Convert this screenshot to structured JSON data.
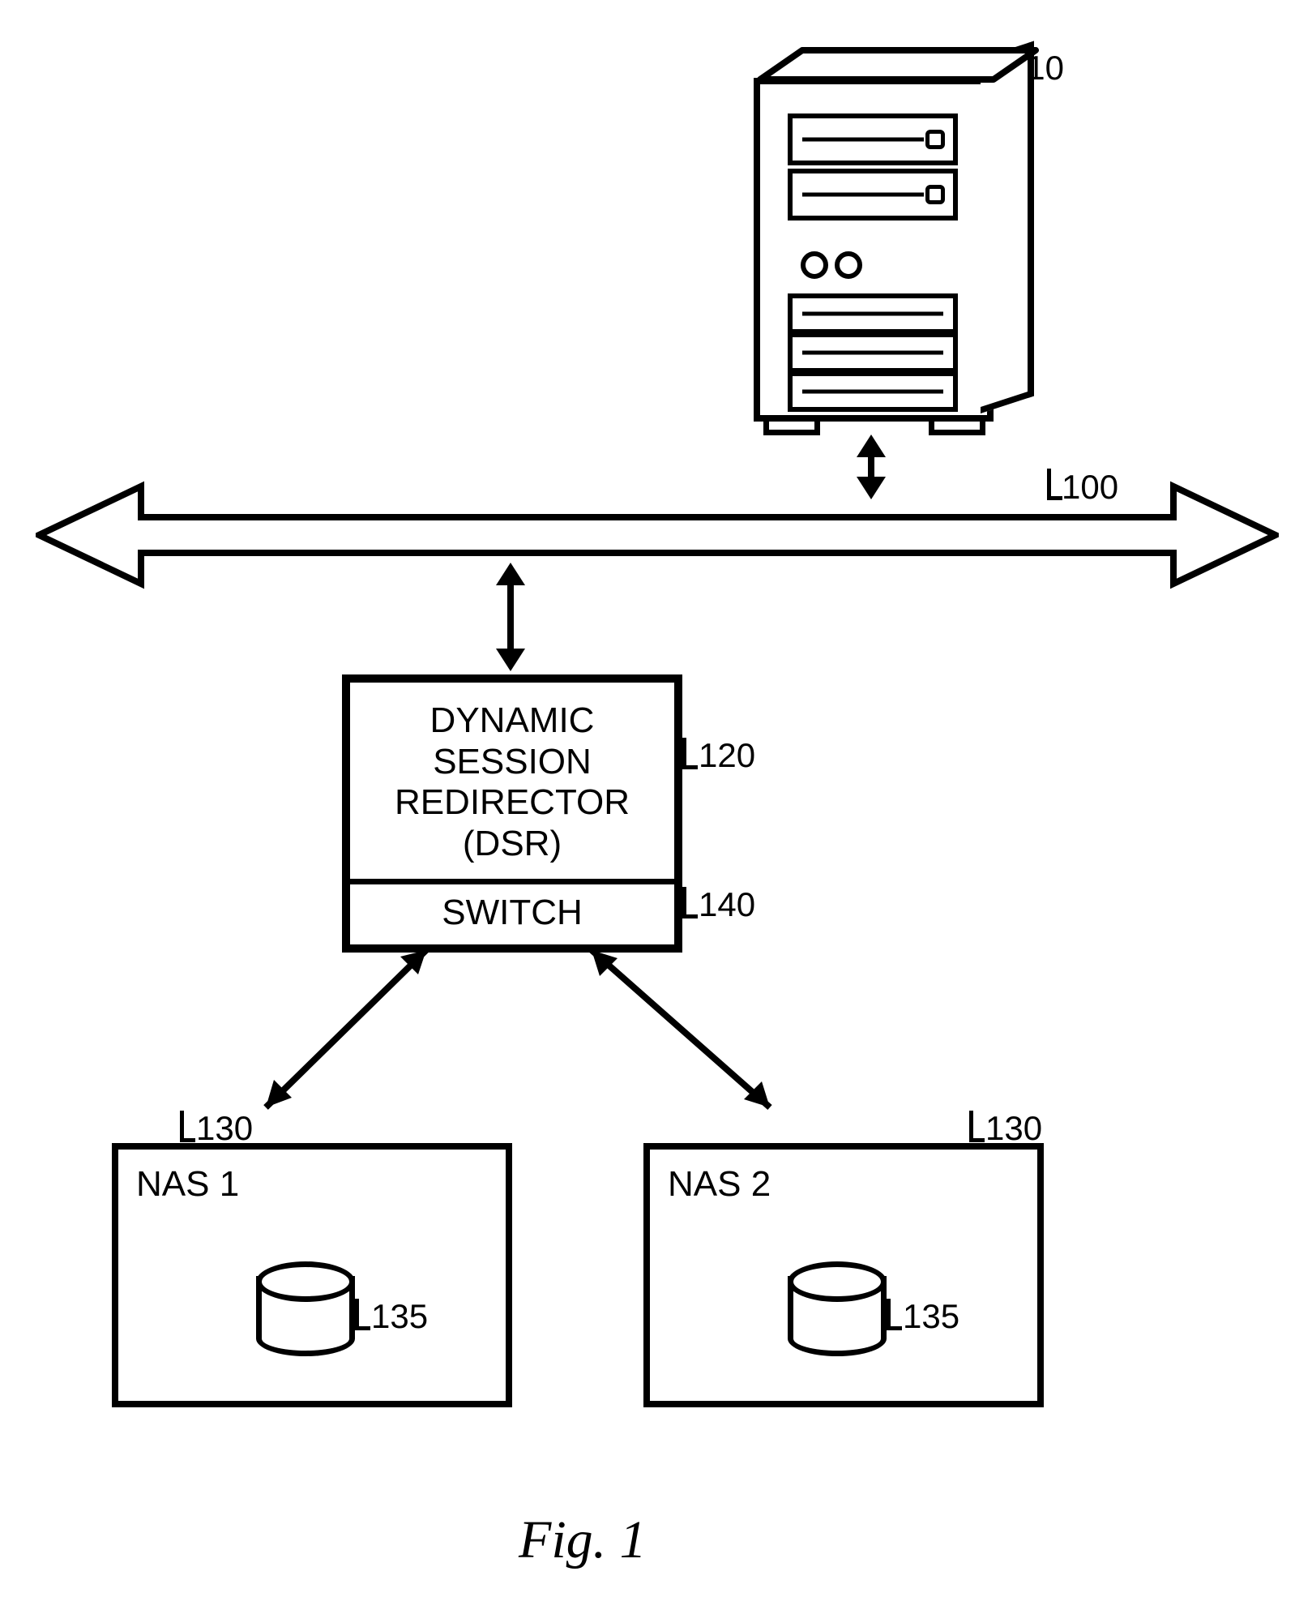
{
  "caption": "Fig. 1",
  "refs": {
    "server": "110",
    "bus": "100",
    "dsr": "120",
    "switch": "140",
    "nas_left": "130",
    "nas_right": "130",
    "disk_left": "135",
    "disk_right": "135"
  },
  "dsr": {
    "line1": "DYNAMIC",
    "line2": "SESSION",
    "line3": "REDIRECTOR",
    "line4": "(DSR)",
    "switch": "SWITCH"
  },
  "nas": {
    "left_label": "NAS 1",
    "right_label": "NAS 2"
  }
}
